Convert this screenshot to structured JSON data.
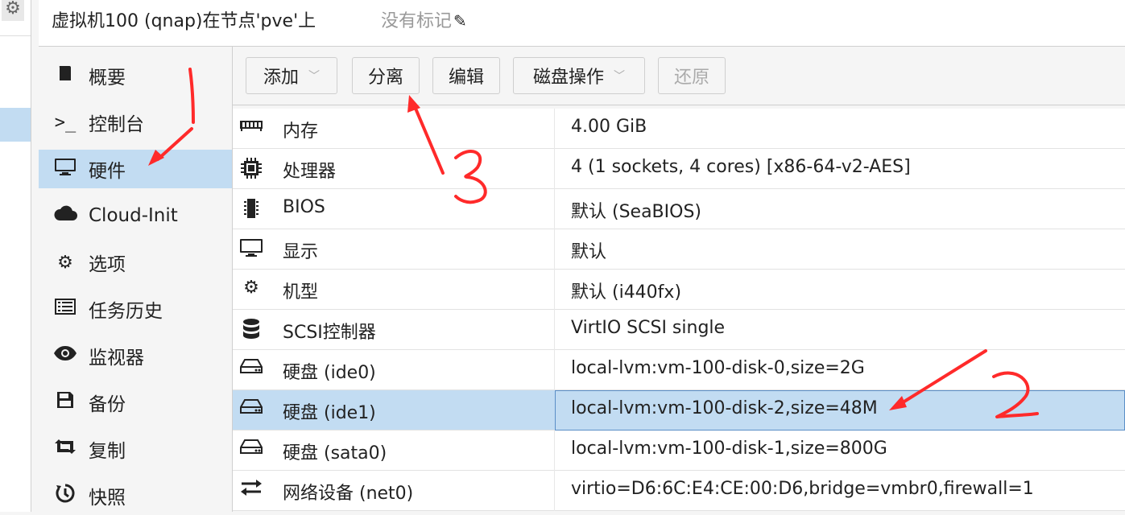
{
  "header": {
    "title": "虚拟机100 (qnap)在节点'pve'上",
    "tags": "没有标记"
  },
  "nav": {
    "items": [
      {
        "label": "概要",
        "icon": "book-icon"
      },
      {
        "label": "控制台",
        "icon": "terminal-icon"
      },
      {
        "label": "硬件",
        "icon": "monitor-icon",
        "active": true
      },
      {
        "label": "Cloud-Init",
        "icon": "cloud-icon"
      },
      {
        "label": "选项",
        "icon": "gear-icon"
      },
      {
        "label": "任务历史",
        "icon": "list-icon"
      },
      {
        "label": "监视器",
        "icon": "eye-icon"
      },
      {
        "label": "备份",
        "icon": "floppy-icon"
      },
      {
        "label": "复制",
        "icon": "retweet-icon"
      },
      {
        "label": "快照",
        "icon": "history-icon"
      }
    ]
  },
  "toolbar": {
    "add": "添加",
    "detach": "分离",
    "edit": "编辑",
    "disk_action": "磁盘操作",
    "revert": "还原"
  },
  "hardware": [
    {
      "name": "内存",
      "value": "4.00 GiB",
      "icon": "memory-icon"
    },
    {
      "name": "处理器",
      "value": "4 (1 sockets, 4 cores) [x86-64-v2-AES]",
      "icon": "cpu-icon"
    },
    {
      "name": "BIOS",
      "value": "默认 (SeaBIOS)",
      "icon": "microchip-icon"
    },
    {
      "name": "显示",
      "value": "默认",
      "icon": "display-icon"
    },
    {
      "name": "机型",
      "value": "默认 (i440fx)",
      "icon": "cogs-icon"
    },
    {
      "name": "SCSI控制器",
      "value": "VirtIO SCSI single",
      "icon": "database-icon"
    },
    {
      "name": "硬盘 (ide0)",
      "value": "local-lvm:vm-100-disk-0,size=2G",
      "icon": "hdd-icon"
    },
    {
      "name": "硬盘 (ide1)",
      "value": "local-lvm:vm-100-disk-2,size=48M",
      "icon": "hdd-icon",
      "selected": true
    },
    {
      "name": "硬盘 (sata0)",
      "value": "local-lvm:vm-100-disk-1,size=800G",
      "icon": "hdd-icon"
    },
    {
      "name": "网络设备 (net0)",
      "value": "virtio=D6:6C:E4:CE:00:D6,bridge=vmbr0,firewall=1",
      "icon": "exchange-icon"
    }
  ],
  "colors": {
    "selection": "#c2dcf2",
    "annotation": "#ff2a2a"
  }
}
